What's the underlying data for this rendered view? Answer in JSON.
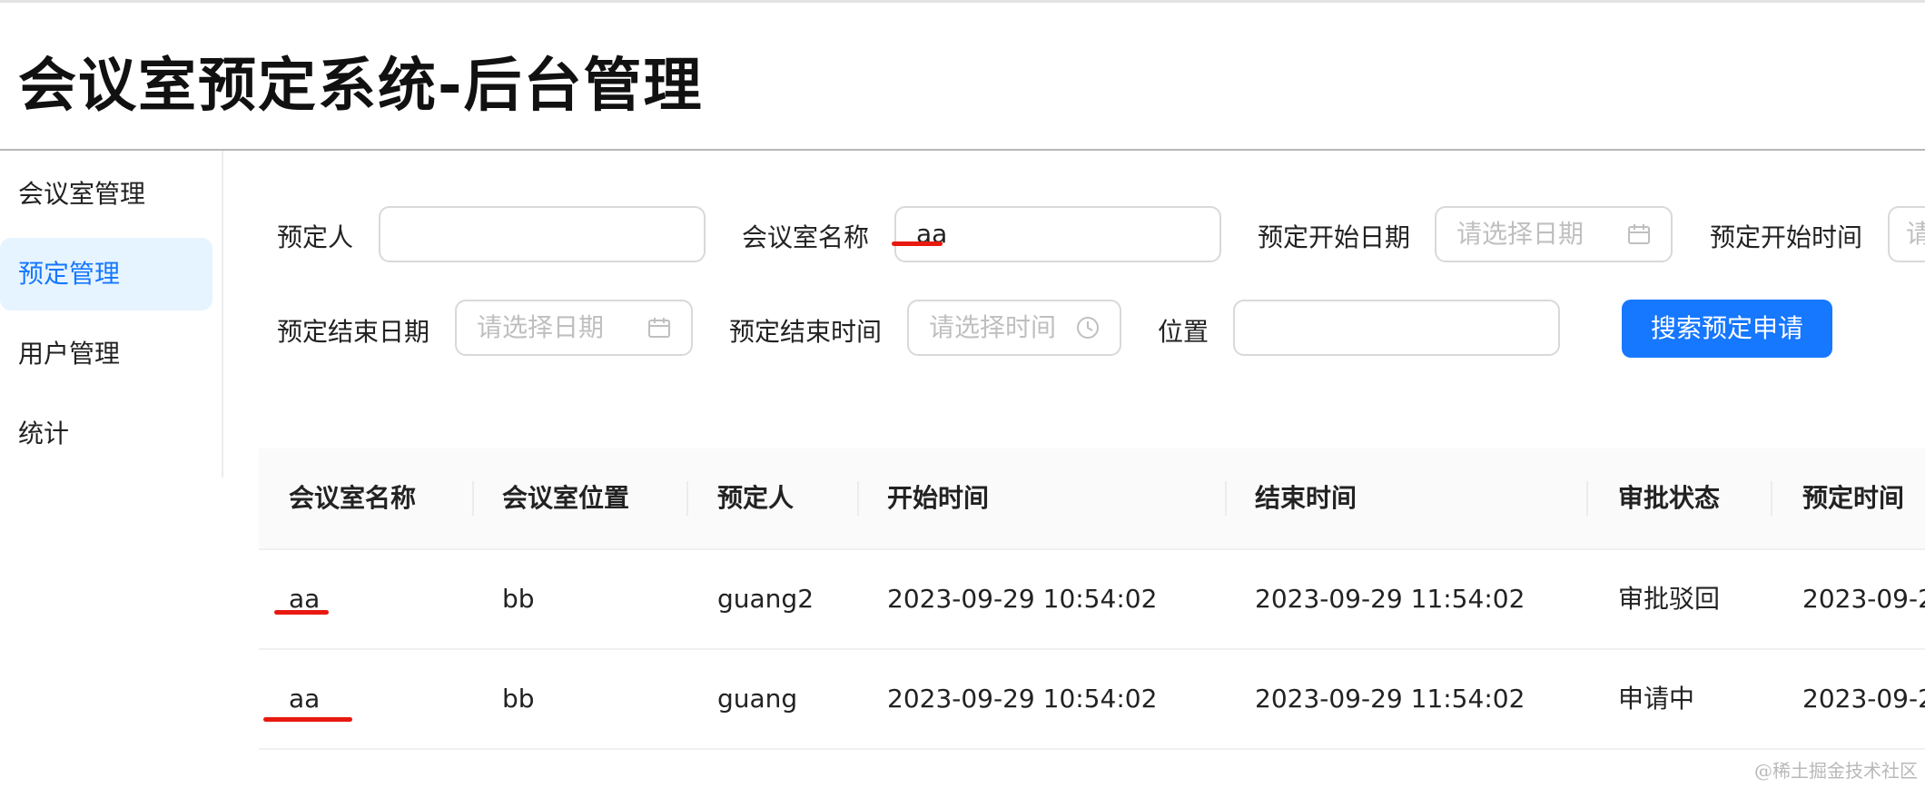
{
  "app": {
    "title": "会议室预定系统-后台管理"
  },
  "sidebar": {
    "items": [
      {
        "label": "会议室管理"
      },
      {
        "label": "预定管理"
      },
      {
        "label": "用户管理"
      },
      {
        "label": "统计"
      }
    ],
    "selected": "预定管理"
  },
  "search": {
    "booker_label": "预定人",
    "booker_value": "",
    "room_name_label": "会议室名称",
    "room_name_value": "aa",
    "start_date_label": "预定开始日期",
    "start_date_placeholder": "请选择日期",
    "start_time_label": "预定开始时间",
    "start_time_placeholder": "请",
    "end_date_label": "预定结束日期",
    "end_date_placeholder": "请选择日期",
    "end_time_label": "预定结束时间",
    "end_time_placeholder": "请选择时间",
    "location_label": "位置",
    "location_value": "",
    "submit_label": "搜索预定申请"
  },
  "table": {
    "columns": [
      "会议室名称",
      "会议室位置",
      "预定人",
      "开始时间",
      "结束时间",
      "审批状态",
      "预定时间"
    ],
    "rows": [
      [
        "aa",
        "bb",
        "guang2",
        "2023-09-29 10:54:02",
        "2023-09-29 11:54:02",
        "审批驳回",
        "2023-09-2"
      ],
      [
        "aa",
        "bb",
        "guang",
        "2023-09-29 10:54:02",
        "2023-09-29 11:54:02",
        "申请中",
        "2023-09-2"
      ]
    ]
  },
  "watermark": "@稀土掘金技术社区",
  "colors": {
    "primary": "#1677ff",
    "selected_bg": "#e6f4ff",
    "annotation": "#e8190f"
  }
}
